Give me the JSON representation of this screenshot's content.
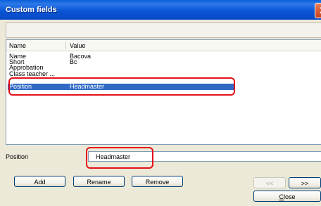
{
  "window": {
    "title": "Custom fields",
    "close_glyph": "X"
  },
  "list": {
    "columns": {
      "name": "Name",
      "value": "Value"
    },
    "rows": [
      {
        "name": "Name",
        "value": "Bacova"
      },
      {
        "name": "Short",
        "value": "Bc"
      },
      {
        "name": "Approbation",
        "value": ""
      },
      {
        "name": "Class teacher ...",
        "value": ""
      },
      {
        "name": "Position",
        "value": "Headmaster",
        "selected": true
      }
    ]
  },
  "field": {
    "label": "Position",
    "value": "Headmaster"
  },
  "buttons": {
    "add": "Add",
    "rename": "Rename",
    "remove": "Remove",
    "prev": "<<",
    "next": ">>",
    "close_first": "C",
    "close_rest": "lose"
  },
  "colors": {
    "highlight": "#e3101a",
    "selection": "#316ac5"
  }
}
